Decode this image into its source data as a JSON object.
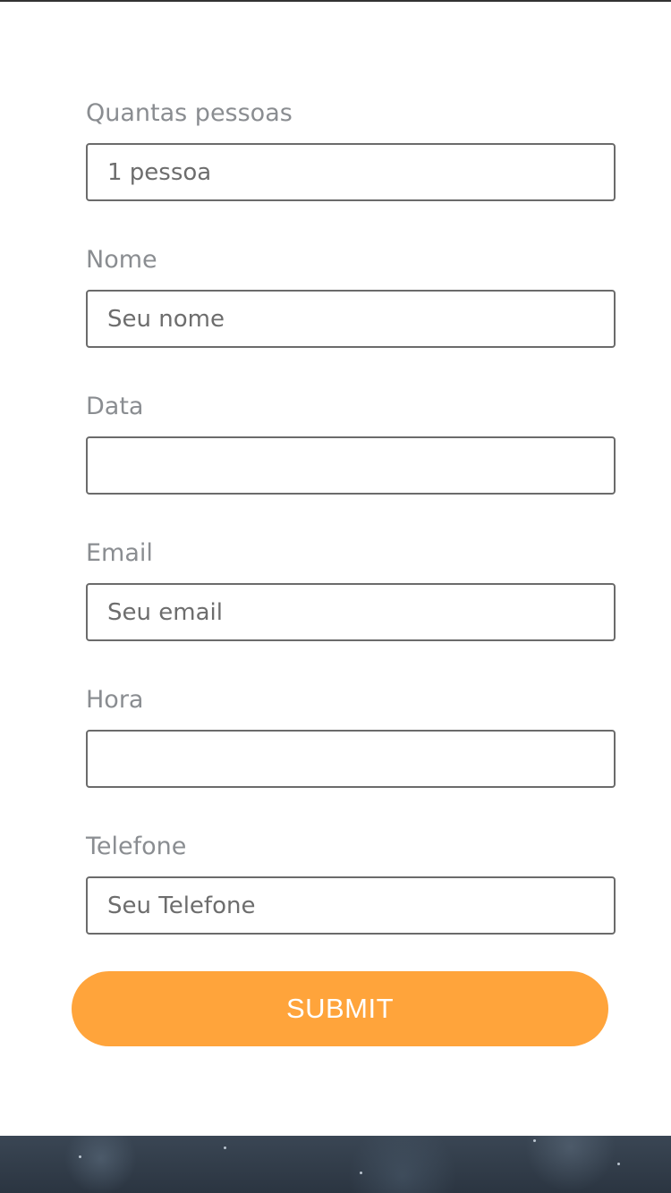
{
  "form": {
    "fields": [
      {
        "label": "Quantas pessoas",
        "value": "1 pessoa",
        "placeholder": ""
      },
      {
        "label": "Nome",
        "value": "",
        "placeholder": "Seu nome"
      },
      {
        "label": "Data",
        "value": "",
        "placeholder": ""
      },
      {
        "label": "Email",
        "value": "",
        "placeholder": "Seu email"
      },
      {
        "label": "Hora",
        "value": "",
        "placeholder": ""
      },
      {
        "label": "Telefone",
        "value": "",
        "placeholder": "Seu Telefone"
      }
    ],
    "submit_label": "SUBMIT"
  },
  "colors": {
    "accent": "#ffa43b",
    "label": "#8a8d91",
    "border": "#6b6b6b",
    "footer": "#2b3541"
  }
}
